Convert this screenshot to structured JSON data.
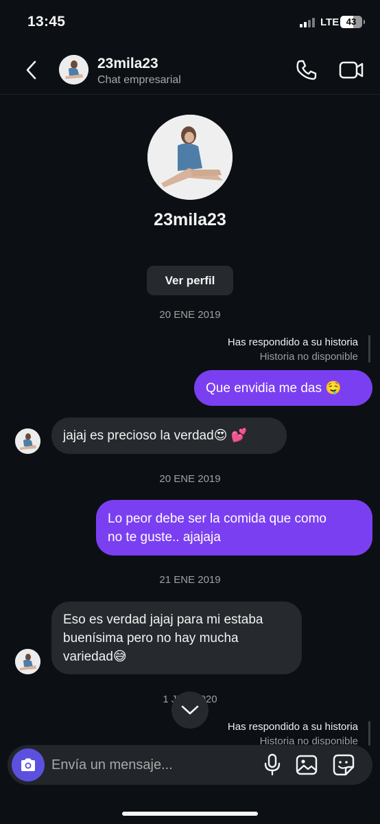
{
  "status_bar": {
    "time": "13:45",
    "network": "LTE",
    "battery": "43"
  },
  "header": {
    "username": "23mila23",
    "subtitle": "Chat empresarial"
  },
  "profile": {
    "name": "23mila23",
    "view_profile_label": "Ver perfil"
  },
  "thread": {
    "date_1": "20 ENE 2019",
    "reply_1": {
      "line1": "Has respondido a su historia",
      "line2": "Historia no disponible"
    },
    "msg_1": "Que envidia me das 🤤",
    "msg_2": "jajaj es precioso la verdad😍 💕",
    "date_2": "20 ENE 2019",
    "msg_3_line1": "Lo peor debe ser la comida que como",
    "msg_3_line2": "no te guste.. ajajaja",
    "date_3": "21 ENE 2019",
    "msg_4_line1": "Eso es verdad jajaj para mi estaba",
    "msg_4_line2": "buenísima pero no hay mucha",
    "msg_4_line3": "variedad😅",
    "date_4": "1 JUN 2020",
    "reply_2": {
      "line1": "Has respondido a su historia",
      "line2": "Historia no disponible"
    }
  },
  "composer": {
    "placeholder": "Envía un mensaje..."
  },
  "icons": {
    "back": "chevron-left-icon",
    "call": "phone-icon",
    "video": "video-camera-icon",
    "scroll": "chevron-down-icon",
    "camera": "camera-icon",
    "mic": "microphone-icon",
    "gallery": "image-icon",
    "sticker": "sticker-icon"
  },
  "colors": {
    "outgoing_bubble": "#7b3ff2",
    "incoming_bubble": "#26292e",
    "camera_button": "#5b51de",
    "background": "#0c1014"
  }
}
